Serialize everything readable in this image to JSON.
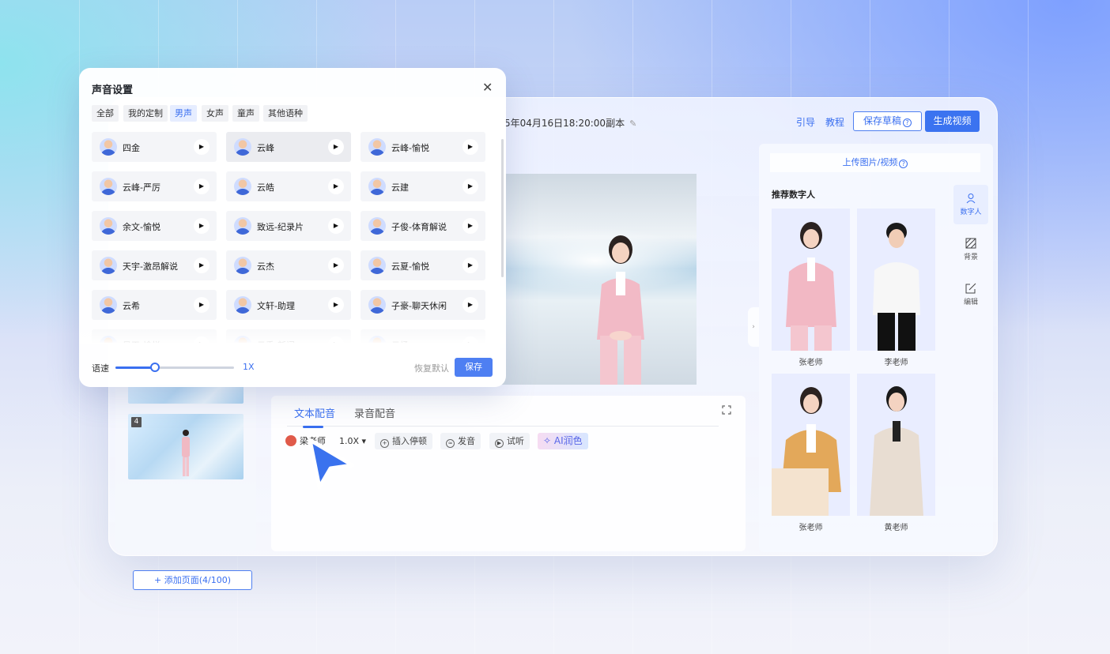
{
  "app": {
    "doc_title": "5年04月16日18:20:00副本",
    "guide": "引导",
    "tutorial": "教程",
    "save_draft": "保存草稿",
    "generate": "生成视频"
  },
  "pages": {
    "thumb_number": "4",
    "add_page": "+ 添加页面(4/100)"
  },
  "editor": {
    "tabs": [
      "文本配音",
      "录音配音"
    ],
    "speaker": "梁老师",
    "speed": "1.0X",
    "tools": [
      "插入停顿",
      "发音",
      "试听",
      "AI润色"
    ]
  },
  "right_panel": {
    "upload": "上传图片/视频",
    "recommend_title": "推荐数字人",
    "avatars": [
      "张老师",
      "李老师",
      "张老师",
      "黄老师"
    ],
    "nav": [
      "数字人",
      "背景",
      "编辑"
    ]
  },
  "dialog": {
    "title": "声音设置",
    "filters": [
      "全部",
      "我的定制",
      "男声",
      "女声",
      "童声",
      "其他语种"
    ],
    "active_filter": "男声",
    "voices": [
      "四金",
      "云峰",
      "云峰-愉悦",
      "云峰-严厉",
      "云皓",
      "云建",
      "余文-愉悦",
      "致远-纪录片",
      "子俊-体育解说",
      "天宇-激昂解说",
      "云杰",
      "云夏-愉悦",
      "云希",
      "文轩-助理",
      "子豪-聊天休闲",
      "昊天-愉悦",
      "云秀-新闻",
      "云扬"
    ],
    "selected_voice": "云峰",
    "speed_label": "语速",
    "speed_value": "1X",
    "speed_fraction": 0.33,
    "reset": "恢复默认",
    "save": "保存"
  },
  "colors": {
    "accent": "#3a6ff0",
    "primary_button": "#3b73f0"
  }
}
